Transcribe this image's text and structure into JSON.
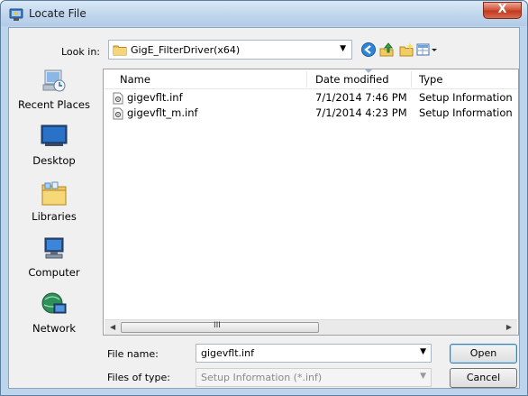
{
  "window": {
    "title": "Locate File",
    "close_label": "X"
  },
  "toolbar": {
    "look_in_label": "Look in:",
    "look_in_value": "GigE_FilterDriver(x64)",
    "icons": [
      "back-icon",
      "up-folder-icon",
      "new-folder-icon",
      "view-menu-icon"
    ]
  },
  "places": [
    {
      "label": "Recent Places",
      "icon": "recent-places-icon"
    },
    {
      "label": "Desktop",
      "icon": "desktop-icon"
    },
    {
      "label": "Libraries",
      "icon": "libraries-icon"
    },
    {
      "label": "Computer",
      "icon": "computer-icon"
    },
    {
      "label": "Network",
      "icon": "network-icon"
    }
  ],
  "filelist": {
    "columns": [
      "Name",
      "Date modified",
      "Type"
    ],
    "rows": [
      {
        "name": "gigevflt.inf",
        "date": "7/1/2014 7:46 PM",
        "type": "Setup Information"
      },
      {
        "name": "gigevflt_m.inf",
        "date": "7/1/2014 4:23 PM",
        "type": "Setup Information"
      }
    ],
    "scroll_grip": "III"
  },
  "form": {
    "file_name_label": "File name:",
    "file_name_value": "gigevflt.inf",
    "file_type_label": "Files of type:",
    "file_type_value": "Setup Information (*.inf)",
    "open_label": "Open",
    "cancel_label": "Cancel"
  }
}
